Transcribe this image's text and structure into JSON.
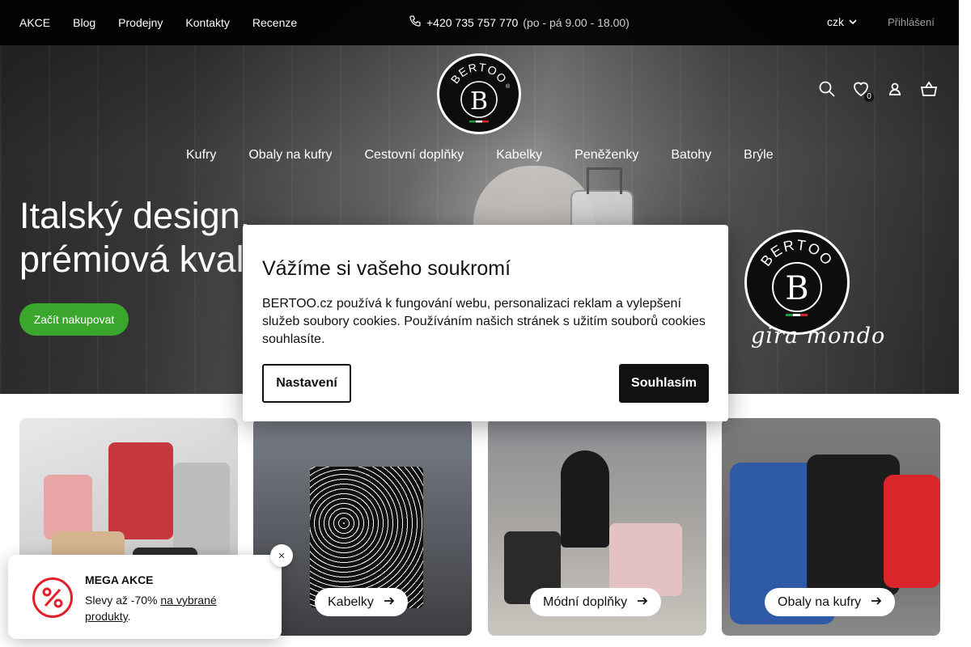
{
  "topbar": {
    "links": [
      "AKCE",
      "Blog",
      "Prodejny",
      "Kontakty",
      "Recenze"
    ],
    "phone": "+420 735 757 770",
    "hours": "(po - pá 9.00 - 18.00)",
    "currency": "czk",
    "login": "Přihlášení"
  },
  "logo": {
    "text": "BERTOO",
    "mark": "B",
    "registered": "®"
  },
  "header": {
    "icons": [
      "search-icon",
      "heart-icon",
      "user-icon",
      "basket-icon"
    ],
    "wishlist_count": "0"
  },
  "main_nav": [
    "Kufry",
    "Obaly na kufry",
    "Cestovní doplňky",
    "Kabelky",
    "Peněženky",
    "Batohy",
    "Brýle"
  ],
  "hero": {
    "title_line1": "Italský design,",
    "title_line2": "prémiová kval",
    "cta": "Začít nakupovat",
    "badge_text": "BERTOO",
    "tagline": "gira mondo"
  },
  "categories": [
    {
      "label": ""
    },
    {
      "label": "Kabelky"
    },
    {
      "label": "Módní doplňky"
    },
    {
      "label": "Obaly na kufry"
    }
  ],
  "cookie": {
    "title": "Vážíme si vašeho soukromí",
    "text": "BERTOO.cz používá k fungování webu, personalizaci reklam a vylepšení služeb soubory cookies. Používáním našich stránek s užitím souborů cookies souhlasíte.",
    "settings": "Nastavení",
    "accept": "Souhlasím"
  },
  "promo": {
    "title": "MEGA AKCE",
    "text_prefix": "Slevy až -70% ",
    "link": "na vybrané produkty",
    "text_suffix": ".",
    "close": "✕"
  },
  "colors": {
    "accent_green": "#3aa62b",
    "promo_red": "#e2222b",
    "topbar": "#000000"
  }
}
